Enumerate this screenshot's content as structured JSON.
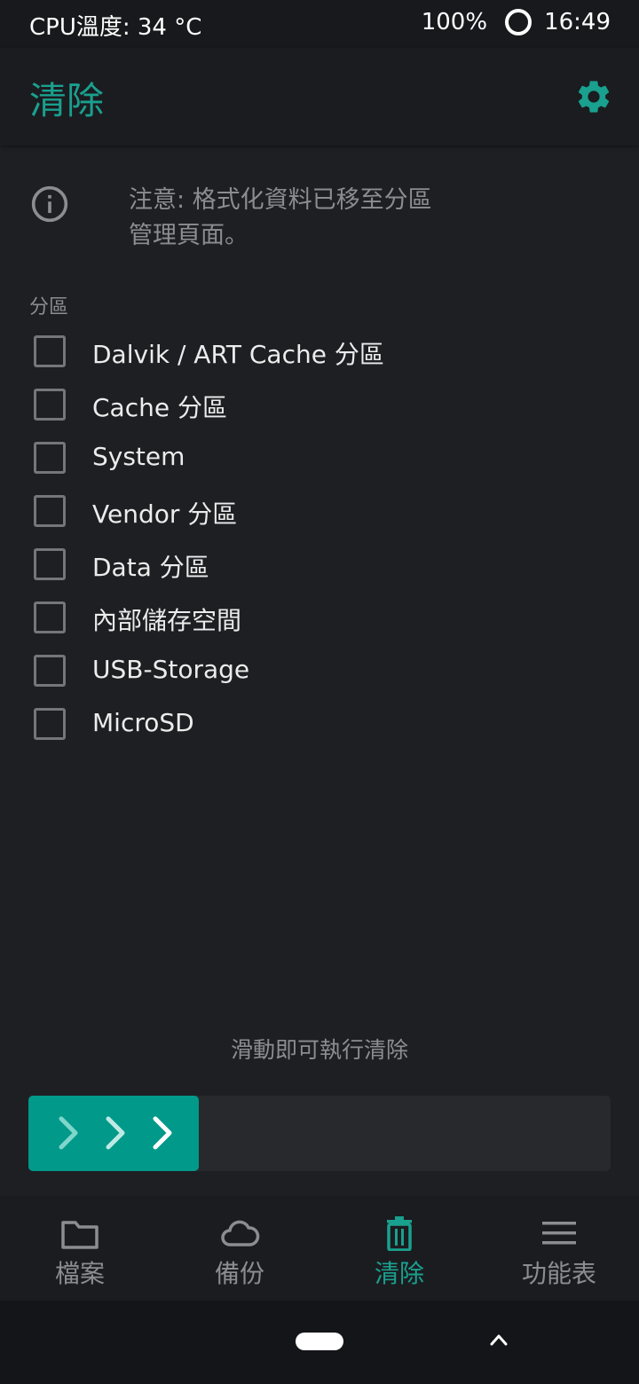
{
  "status_bar": {
    "cpu_temp": "CPU溫度: 34 °C",
    "battery": "100%",
    "time": "16:49"
  },
  "app_bar": {
    "title": "清除",
    "settings_icon": "gear-icon"
  },
  "notice": {
    "icon": "info-icon",
    "text": "注意: 格式化資料已移至分區管理頁面。"
  },
  "partitions": {
    "label": "分區",
    "items": [
      {
        "label": "Dalvik / ART Cache 分區",
        "checked": false
      },
      {
        "label": "Cache 分區",
        "checked": false
      },
      {
        "label": "System",
        "checked": false
      },
      {
        "label": "Vendor 分區",
        "checked": false
      },
      {
        "label": "Data 分區",
        "checked": false
      },
      {
        "label": "內部儲存空間",
        "checked": false
      },
      {
        "label": "USB-Storage",
        "checked": false
      },
      {
        "label": "MicroSD",
        "checked": false
      }
    ]
  },
  "swipe": {
    "hint": "滑動即可執行清除",
    "handle_icon": "triple-chevron-right-icon"
  },
  "bottom_nav": {
    "items": [
      {
        "label": "檔案",
        "icon": "folder-icon",
        "active": false
      },
      {
        "label": "備份",
        "icon": "cloud-icon",
        "active": false
      },
      {
        "label": "清除",
        "icon": "trash-icon",
        "active": true
      },
      {
        "label": "功能表",
        "icon": "menu-icon",
        "active": false
      }
    ]
  },
  "colors": {
    "accent": "#1aa08e",
    "swipe_handle": "#00998a",
    "background": "#1e1f23"
  }
}
